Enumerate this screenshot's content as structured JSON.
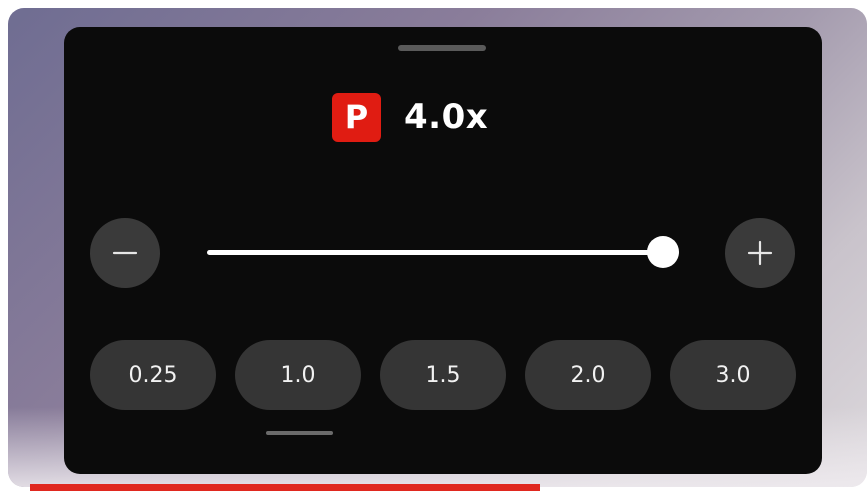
{
  "header": {
    "badge_letter": "P",
    "speed_value": "4.0x"
  },
  "slider": {
    "level": 0.97
  },
  "controls": {
    "decrease_icon": "minus-icon",
    "increase_icon": "plus-icon"
  },
  "presets": [
    "0.25",
    "1.0",
    "1.5",
    "2.0",
    "3.0"
  ],
  "colors": {
    "accent": "#e01c12",
    "sheet_bg": "#0b0b0b",
    "button_bg": "#353535",
    "progress": "#e0281f"
  }
}
